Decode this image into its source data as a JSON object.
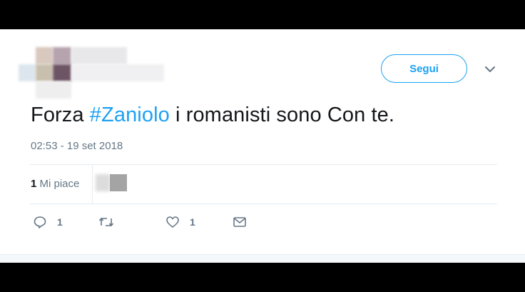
{
  "user": {
    "avatar_icon": "blurred-avatar",
    "name": "",
    "handle": ""
  },
  "header": {
    "follow_label": "Segui",
    "menu_icon": "chevron-down-icon"
  },
  "tweet": {
    "text_before": "Forza ",
    "hashtag": "#Zaniolo",
    "text_after": " i romanisti sono Con te.",
    "timestamp": "02:53 - 19 set 2018"
  },
  "stats": {
    "likes_count": "1",
    "likes_label": "Mi piace"
  },
  "actions": {
    "reply": {
      "icon": "reply-icon",
      "count": "1"
    },
    "retweet": {
      "icon": "retweet-icon",
      "count": ""
    },
    "like": {
      "icon": "heart-icon",
      "count": "1"
    },
    "dm": {
      "icon": "envelope-icon",
      "count": ""
    }
  },
  "colors": {
    "accent": "#1da1f2",
    "text": "#14171a",
    "muted": "#657786",
    "border": "#e6ecf0"
  }
}
